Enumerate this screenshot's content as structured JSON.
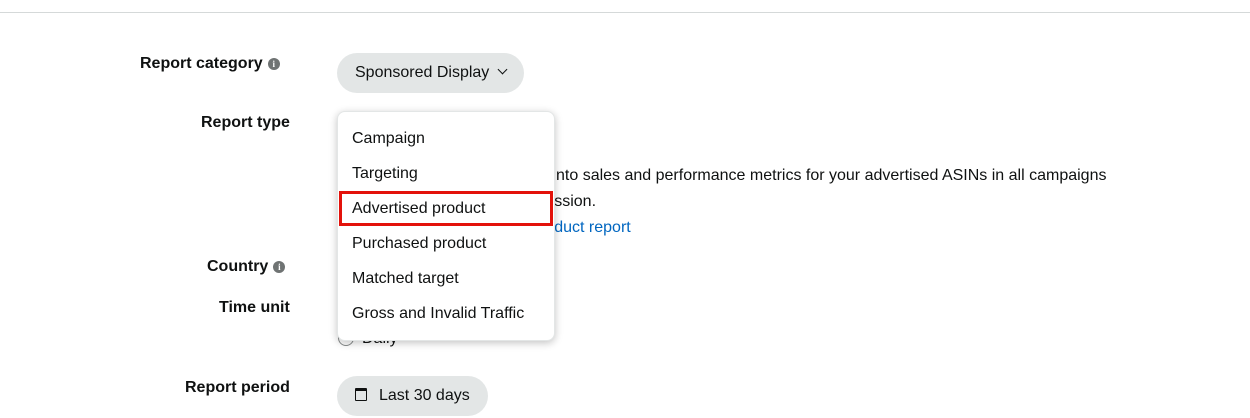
{
  "form": {
    "report_category": {
      "label": "Report category",
      "value": "Sponsored Display"
    },
    "report_type": {
      "label": "Report type",
      "options": [
        "Campaign",
        "Targeting",
        "Advertised product",
        "Purchased product",
        "Matched target",
        "Gross and Invalid Traffic"
      ],
      "highlighted": "Advertised product",
      "description_line1": "s into sales and performance metrics for your advertised ASINs in all campaigns",
      "description_line2": "ression.",
      "description_link": "roduct report"
    },
    "country": {
      "label": "Country"
    },
    "time_unit": {
      "label": "Time unit",
      "radio_label": "Daily"
    },
    "report_period": {
      "label": "Report period",
      "value": "Last 30 days"
    }
  },
  "icons": {
    "info": "info-icon",
    "chevron": "chevron-down-icon",
    "calendar": "calendar-icon"
  },
  "colors": {
    "pill_bg": "#e3e6e6",
    "link": "#0066c0",
    "highlight_border": "#e3120b"
  }
}
